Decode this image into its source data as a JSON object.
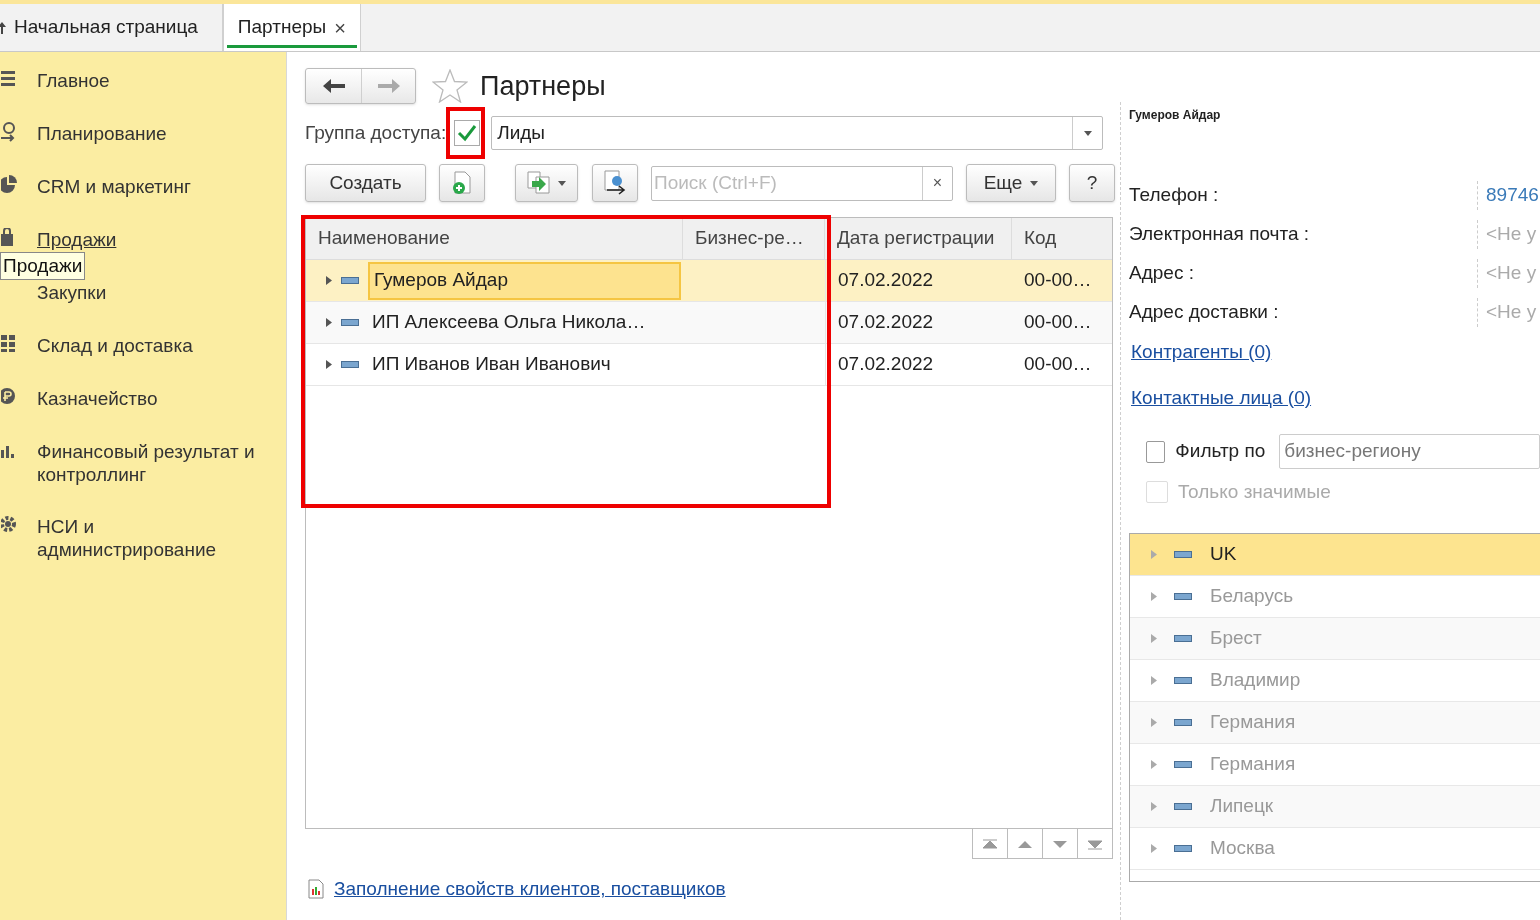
{
  "tabs": [
    {
      "label": "Начальная страница",
      "kind": "home",
      "selected": false
    },
    {
      "label": "Партнеры",
      "kind": "closable",
      "close": "×",
      "selected": true
    }
  ],
  "sidebar": {
    "items": [
      {
        "label": "Главное",
        "hovered": false
      },
      {
        "label": "Планирование",
        "hovered": false
      },
      {
        "label": "CRM и маркетинг",
        "hovered": false
      },
      {
        "label": "Продажи",
        "hovered": true
      },
      {
        "label": "Закупки",
        "hovered": false
      },
      {
        "label": "Склад и доставка",
        "hovered": false
      },
      {
        "label": "Казначейство",
        "hovered": false
      },
      {
        "label": "Финансовый результат и контроллинг",
        "hovered": false
      },
      {
        "label": "НСИ и администрирование",
        "hovered": false
      }
    ],
    "tooltip": "Продажи"
  },
  "form": {
    "title": "Партнеры",
    "access_group": {
      "label": "Группа доступа:",
      "checked": true,
      "value": "Лиды"
    },
    "toolbar": {
      "create": "Создать",
      "search_placeholder": "Поиск (Ctrl+F)",
      "clear": "×",
      "more": "Еще",
      "help": "?"
    },
    "table": {
      "columns": [
        "Наименование",
        "Бизнес-ре…",
        "Дата регистрации",
        "Код"
      ],
      "rows": [
        {
          "cells": [
            "Гумеров Айдар",
            "",
            "07.02.2022",
            "00-00…"
          ],
          "selected": true
        },
        {
          "cells": [
            "ИП Алексеева Ольга Никола…",
            "",
            "07.02.2022",
            "00-00…"
          ],
          "selected": false
        },
        {
          "cells": [
            "ИП Иванов Иван Иванович",
            "",
            "07.02.2022",
            "00-00…"
          ],
          "selected": false
        }
      ]
    },
    "report_link": "Заполнение свойств клиентов, поставщиков"
  },
  "details": {
    "name": "Гумеров Айдар",
    "fields": [
      {
        "label": "Телефон :",
        "value": "89746",
        "kind": "link"
      },
      {
        "label": "Электронная почта :",
        "value": "<Не у",
        "kind": "empty"
      },
      {
        "label": "Адрес :",
        "value": "<Не у",
        "kind": "empty"
      },
      {
        "label": "Адрес доставки :",
        "value": "<Не у",
        "kind": "empty"
      }
    ],
    "links": [
      "Контрагенты (0)",
      "Контактные лица (0)"
    ],
    "filter": {
      "label": "Фильтр по",
      "checked": false,
      "value": "бизнес-региону"
    },
    "only_significant": {
      "label": "Только значимые",
      "checked": false,
      "disabled": true
    },
    "regions": [
      {
        "label": "UK",
        "selected": true
      },
      {
        "label": "Беларусь",
        "selected": false
      },
      {
        "label": "Брест",
        "selected": false
      },
      {
        "label": "Владимир",
        "selected": false
      },
      {
        "label": "Германия",
        "selected": false
      },
      {
        "label": "Германия",
        "selected": false
      },
      {
        "label": "Липецк",
        "selected": false
      },
      {
        "label": "Москва",
        "selected": false
      }
    ]
  }
}
